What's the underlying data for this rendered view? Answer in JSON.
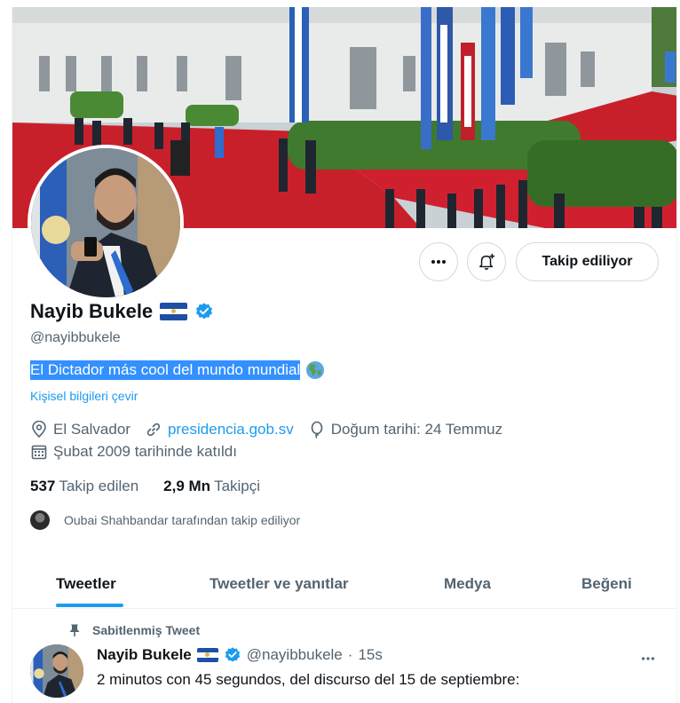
{
  "profile": {
    "name": "Nayib Bukele",
    "handle": "@nayibbukele",
    "bio": "El Dictador más cool del mundo mundial",
    "bio_emoji": "globe-americas",
    "translate_label": "Kişisel bilgileri çevir",
    "location": "El Salvador",
    "website": "presidencia.gob.sv",
    "birthday": "Doğum tarihi: 24 Temmuz",
    "joined": "Şubat 2009 tarihinde katıldı",
    "following_count": "537",
    "following_label": "Takip edilen",
    "followers_count": "2,9 Mn",
    "followers_label": "Takipçi",
    "followed_by": "Oubai Shahbandar tarafından takip ediliyor"
  },
  "actions": {
    "more_icon": "more-icon",
    "notify_icon": "bell-plus-icon",
    "follow_label": "Takip ediliyor"
  },
  "tabs": [
    {
      "label": "Tweetler",
      "active": true
    },
    {
      "label": "Tweetler ve yanıtlar",
      "active": false
    },
    {
      "label": "Medya",
      "active": false
    },
    {
      "label": "Beğeni",
      "active": false
    }
  ],
  "pinned_tweet": {
    "pinned_label": "Sabitlenmiş Tweet",
    "author": "Nayib Bukele",
    "handle": "@nayibbukele",
    "separator": "·",
    "time": "15s",
    "text": "2 minutos con 45 segundos, del discurso del 15 de septiembre:"
  },
  "colors": {
    "accent": "#1d9bf0",
    "text": "#0f1419",
    "secondary": "#536471",
    "selection": "#3390ff",
    "flag_blue": "#1f4fa3"
  }
}
